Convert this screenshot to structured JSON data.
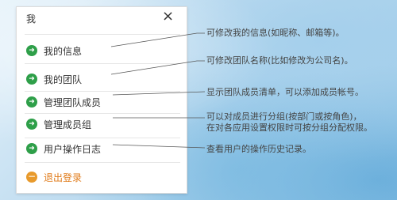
{
  "panel": {
    "title": "我",
    "close_glyph": "×",
    "items": [
      {
        "label": "我的信息",
        "icon": "arrow-right-circle-icon"
      },
      {
        "label": "我的团队",
        "icon": "arrow-right-circle-icon"
      },
      {
        "label": "管理团队成员",
        "icon": "arrow-right-circle-icon"
      },
      {
        "label": "管理成员组",
        "icon": "arrow-right-circle-icon"
      },
      {
        "label": "用户操作日志",
        "icon": "arrow-right-circle-icon"
      }
    ],
    "logout": {
      "label": "退出登录",
      "icon": "minus-circle-icon"
    }
  },
  "annotations": [
    {
      "text": "可修改我的信息(如昵称、邮箱等)。"
    },
    {
      "text": "可修改团队名称(比如修改为公司名)。"
    },
    {
      "text": "显示团队成员清单，可以添加成员帐号。"
    },
    {
      "line1": "可以对成员进行分组(按部门或按角色)，",
      "line2": "在对各应用设置权限时可按分组分配权限。"
    },
    {
      "text": "查看用户的操作历史记录。"
    }
  ],
  "colors": {
    "accent_green": "#2e9f49",
    "logout_orange": "#e07b1a"
  }
}
